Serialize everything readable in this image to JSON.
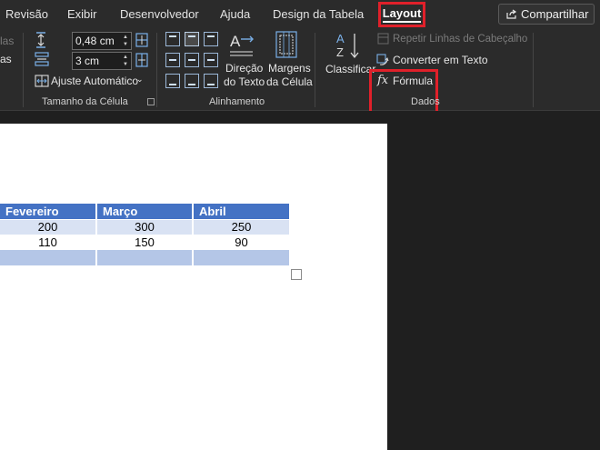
{
  "tabs": {
    "revisao": "Revisão",
    "exibir": "Exibir",
    "desenvolvedor": "Desenvolvedor",
    "ajuda": "Ajuda",
    "design_tabela": "Design da Tabela",
    "layout": "Layout",
    "active": "Layout"
  },
  "share_button": {
    "label": "Compartilhar"
  },
  "ribbon": {
    "clipped_left": {
      "top": "las",
      "mid": "as"
    },
    "cell_size": {
      "height_value": "0,48 cm",
      "width_value": "3 cm",
      "autofit_label": "Ajuste Automático",
      "group_label": "Tamanho da Célula"
    },
    "alignment": {
      "text_direction_line1": "Direção",
      "text_direction_line2": "do Texto",
      "cell_margins_line1": "Margens",
      "cell_margins_line2": "da Célula",
      "group_label": "Alinhamento"
    },
    "data": {
      "sort_label": "Classificar",
      "repeat_header_label": "Repetir Linhas de Cabeçalho",
      "convert_text_label": "Converter em Texto",
      "formula_label": "Fórmula",
      "group_label": "Dados"
    }
  },
  "table": {
    "headers": [
      "Fevereiro",
      "Março",
      "Abril"
    ],
    "rows": [
      [
        "200",
        "300",
        "250"
      ],
      [
        "110",
        "150",
        "90"
      ],
      [
        "",
        "",
        ""
      ]
    ]
  },
  "colors": {
    "accent_highlight": "#e0202a",
    "table_header": "#4472c4",
    "table_band": "#d9e2f3"
  }
}
